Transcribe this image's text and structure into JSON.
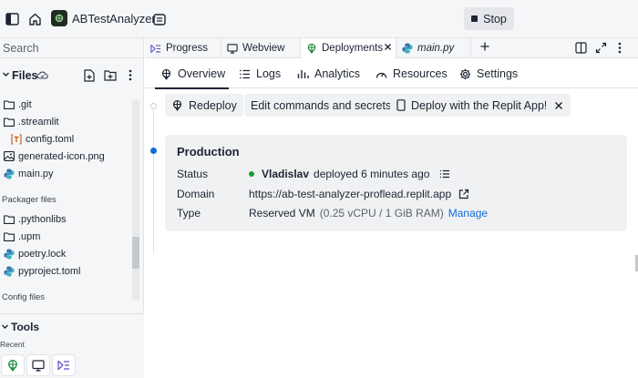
{
  "topbar": {
    "app_name": "ABTestAnalyzer",
    "stop_label": "Stop"
  },
  "sidebar": {
    "search_placeholder": "Search",
    "files_title": "Files",
    "tree": [
      {
        "name": ".git",
        "type": "folder"
      },
      {
        "name": ".streamlit",
        "type": "folder"
      },
      {
        "name": "config.toml",
        "type": "toml"
      },
      {
        "name": "generated-icon.png",
        "type": "image"
      },
      {
        "name": "main.py",
        "type": "python"
      }
    ],
    "packager_label": "Packager files",
    "packager_files": [
      {
        "name": ".pythonlibs",
        "type": "folder"
      },
      {
        "name": ".upm",
        "type": "folder"
      },
      {
        "name": "poetry.lock",
        "type": "python"
      },
      {
        "name": "pyproject.toml",
        "type": "python"
      }
    ],
    "config_label": "Config files",
    "tools_title": "Tools",
    "recent_label": "Recent"
  },
  "tabs": [
    {
      "label": "Progress",
      "icon": "progress-icon"
    },
    {
      "label": "Webview",
      "icon": "monitor-icon"
    },
    {
      "label": "Deployments",
      "icon": "deploy-icon",
      "active": true
    },
    {
      "label": "main.py",
      "icon": "python-icon"
    }
  ],
  "subnav": [
    {
      "label": "Overview",
      "icon": "deploy-icon",
      "active": true
    },
    {
      "label": "Logs",
      "icon": "list-icon"
    },
    {
      "label": "Analytics",
      "icon": "chart-icon"
    },
    {
      "label": "Resources",
      "icon": "gauge-icon"
    },
    {
      "label": "Settings",
      "icon": "gear-icon"
    }
  ],
  "actions": {
    "redeploy": "Redeploy",
    "edit": "Edit commands and secrets",
    "deploy_app": "Deploy with the Replit App!"
  },
  "production": {
    "title": "Production",
    "status_label": "Status",
    "status_user": "Vladislav",
    "status_text": "deployed 6 minutes ago",
    "status_color": "#1a9e3a",
    "domain_label": "Domain",
    "domain_value": "https://ab-test-analyzer-proflead.replit.app",
    "type_label": "Type",
    "type_value": "Reserved VM",
    "type_detail": "(0.25 vCPU / 1 GiB RAM)",
    "manage_label": "Manage"
  },
  "colors": {
    "accent": "#0f6ed6",
    "background": "#f5f6f7",
    "card": "#f0f1f2"
  }
}
